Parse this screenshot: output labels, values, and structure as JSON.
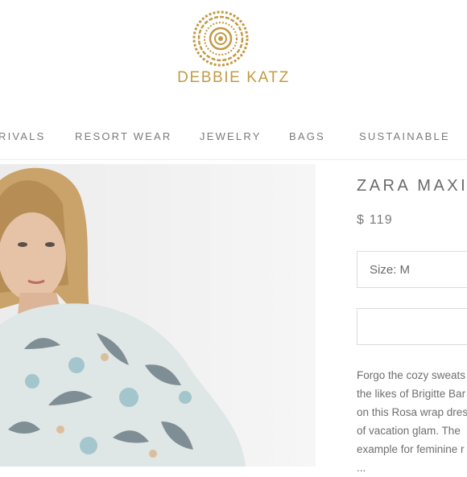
{
  "brand": {
    "name": "DEBBIE KATZ",
    "accent_color": "#c29a45",
    "logo_icon": "mandala-logo-icon"
  },
  "nav": {
    "items": [
      {
        "label": "RIVALS"
      },
      {
        "label": "RESORT WEAR"
      },
      {
        "label": "JEWELRY"
      },
      {
        "label": "BAGS"
      },
      {
        "label": "SUSTAINABLE"
      }
    ]
  },
  "product": {
    "title": "ZARA MAXI",
    "price": "$ 119",
    "size_select": {
      "value": "Size: M"
    },
    "description_lines": [
      "Forgo the cozy sweats",
      "the likes of Brigitte Bar",
      "on this Rosa wrap dres",
      "of vacation glam. The",
      "example for feminine r",
      "..."
    ]
  }
}
